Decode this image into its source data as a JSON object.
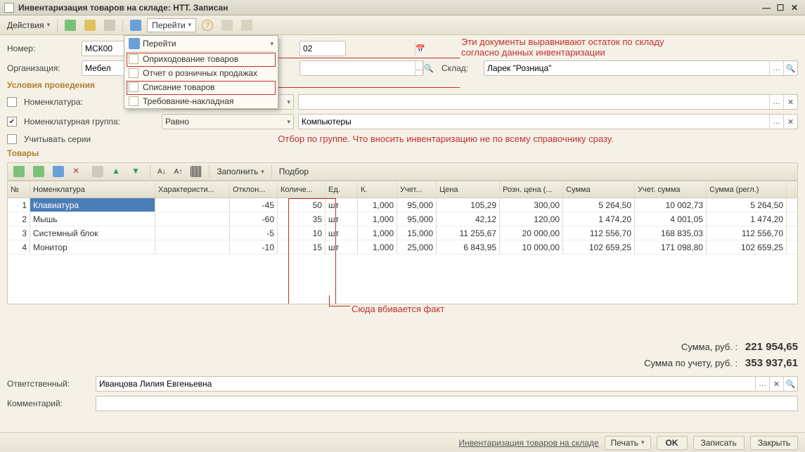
{
  "title": "Инвентаризация товаров на складе: НТТ. Записан",
  "toolbar": {
    "actions": "Действия",
    "goto": "Перейти"
  },
  "dropdown": {
    "head_icon_name": "goto-arrow-icon",
    "items": [
      "Оприходование товаров",
      "Отчет о розничных продажах",
      "Списание товаров",
      "Требование-накладная"
    ]
  },
  "annotations": {
    "top": "Эти документы выравнивают остаток по складу\nсогласно данных инвентаризации",
    "mid": "Отбор по группе. Что вносить инвентаризацию не по всему справочнику сразу.",
    "fact": "Сюда вбивается факт"
  },
  "fields": {
    "number_label": "Номер:",
    "number_value": "МСК00",
    "date_fragment": "02",
    "org_label": "Организация:",
    "org_value": "Мебел",
    "sklad_label": "Склад:",
    "sklad_value": "Ларек \"Розница\""
  },
  "conditions_title": "Условия проведения",
  "filters": {
    "nomenclature_label": "Номенклатура:",
    "nomenclature_checked": false,
    "group_label": "Номенклатурная группа:",
    "group_checked": true,
    "series_label": "Учитывать серии",
    "op": "Равно",
    "group_value": "Компьютеры"
  },
  "goods_title": "Товары",
  "sub_toolbar": {
    "fill": "Заполнить",
    "select": "Подбор"
  },
  "columns": {
    "n": "№",
    "nom": "Номенклатура",
    "char": "Характеристи...",
    "dev": "Отклон...",
    "qty": "Количе...",
    "ed": "Ед.",
    "k": "К.",
    "uprice": "Учет...",
    "price": "Цена",
    "retail": "Розн. цена (...",
    "sum": "Сумма",
    "asum": "Учет. сумма",
    "rsum": "Сумма (регл.)"
  },
  "rows": [
    {
      "n": "1",
      "nom": "Клавиатура",
      "dev": "-45",
      "qty": "50",
      "ed": "шт",
      "k": "1,000",
      "uprice": "95,000",
      "price": "105,29",
      "retail": "300,00",
      "sum": "5 264,50",
      "asum": "10 002,73",
      "rsum": "5 264,50"
    },
    {
      "n": "2",
      "nom": "Мышь",
      "dev": "-60",
      "qty": "35",
      "ed": "шт",
      "k": "1,000",
      "uprice": "95,000",
      "price": "42,12",
      "retail": "120,00",
      "sum": "1 474,20",
      "asum": "4 001,05",
      "rsum": "1 474,20"
    },
    {
      "n": "3",
      "nom": "Системный блок",
      "dev": "-5",
      "qty": "10",
      "ed": "шт",
      "k": "1,000",
      "uprice": "15,000",
      "price": "11 255,67",
      "retail": "20 000,00",
      "sum": "112 556,70",
      "asum": "168 835,03",
      "rsum": "112 556,70"
    },
    {
      "n": "4",
      "nom": "Монитор",
      "dev": "-10",
      "qty": "15",
      "ed": "шт",
      "k": "1,000",
      "uprice": "25,000",
      "price": "6 843,95",
      "retail": "10 000,00",
      "sum": "102 659,25",
      "asum": "171 098,80",
      "rsum": "102 659,25"
    }
  ],
  "totals": {
    "sum_label": "Сумма, руб. :",
    "sum_value": "221 954,65",
    "asum_label": "Сумма по учету, руб. :",
    "asum_value": "353 937,61"
  },
  "bottom": {
    "resp_label": "Ответственный:",
    "resp_value": "Иванцова Лилия Евгеньевна",
    "comment_label": "Комментарий:"
  },
  "footer": {
    "doc_link": "Инвентаризация товаров на складе",
    "print": "Печать",
    "ok": "OK",
    "save": "Записать",
    "close": "Закрыть"
  }
}
